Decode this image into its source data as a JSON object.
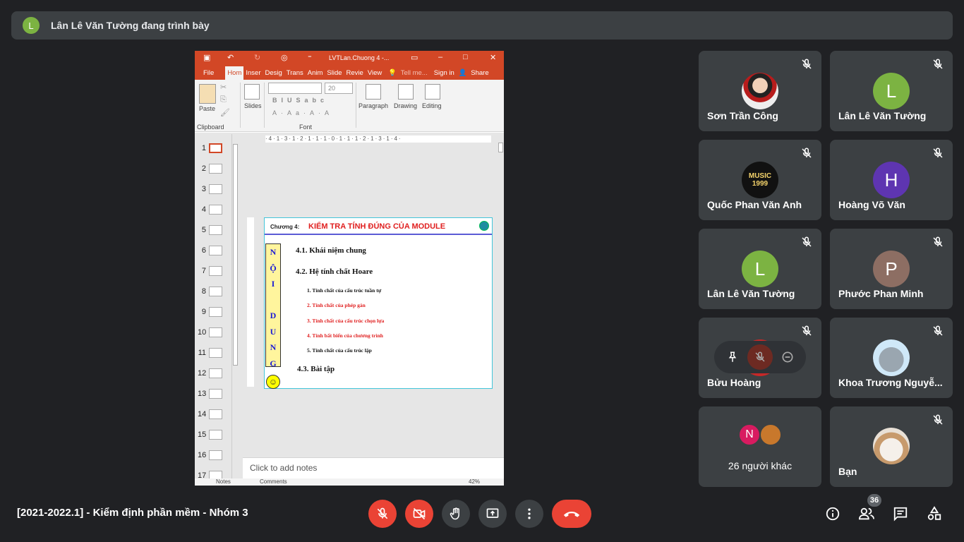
{
  "banner": {
    "avatar_letter": "L",
    "text": "Lân Lê Văn Tường đang trình bày"
  },
  "ppt": {
    "doc_title": "LVTLan.Chuong 4 -...",
    "tabs": [
      "File",
      "Hom",
      "Inser",
      "Desig",
      "Trans",
      "Anim",
      "Slide",
      "Revie",
      "View"
    ],
    "tell_me": "Tell me...",
    "sign_in": "Sign in",
    "share": "Share",
    "ribbon": {
      "paste": "Paste",
      "clipboard": "Clipboard",
      "slides": "Slides",
      "font_size": "20",
      "font": "Font",
      "paragraph": "Paragraph",
      "drawing": "Drawing",
      "editing": "Editing"
    },
    "ruler": "·4·1·3·1·2·1·1·1·0·1·1·1·2·1·3·1·4·",
    "thumbnail_numbers": [
      "1",
      "2",
      "3",
      "4",
      "5",
      "6",
      "7",
      "8",
      "9",
      "10",
      "11",
      "12",
      "13",
      "14",
      "15",
      "16",
      "17"
    ],
    "slide": {
      "chapter": "Chương 4:",
      "title": "KIỂM TRA TÍNH ĐÚNG CỦA MODULE",
      "side_letters": [
        "N",
        "Ộ",
        "I",
        "",
        "D",
        "U",
        "N",
        "G"
      ],
      "smiley": "☺",
      "h1": "4.1. Khái niệm chung",
      "h2": "4.2. Hệ tính chất Hoare",
      "items": [
        "1. Tính chất của cấu trúc tuần tự",
        "2. Tính chất của phép gán",
        "3. Tính chất của cấu trúc chọn lựa",
        "4. Tính bất biến của chương trình",
        "5. Tính chất của cấu trúc lặp"
      ],
      "h3": "4.3. Bài tập"
    },
    "notes_placeholder": "Click to add notes",
    "status": {
      "notes": "Notes",
      "comments": "Comments",
      "zoom": "42%"
    }
  },
  "participants": [
    {
      "name": "Sơn Trần Công",
      "avatar": "photo"
    },
    {
      "name": "Lân Lê Văn Tường",
      "avatar": "L",
      "color": "#7cb342"
    },
    {
      "name": "Quốc Phan Văn Anh",
      "avatar": "MUSIC 1999"
    },
    {
      "name": "Hoàng Võ Văn",
      "avatar": "H",
      "color": "#5e35b1"
    },
    {
      "name": "Lân Lê Văn Tường",
      "avatar": "L",
      "color": "#7cb342"
    },
    {
      "name": "Phước Phan Minh",
      "avatar": "P",
      "color": "#8d6e63"
    },
    {
      "name": "Bửu Hoàng",
      "avatar": "photo"
    },
    {
      "name": "Khoa Trương Nguyễ...",
      "avatar": "photo"
    },
    {
      "name": "26 người khác",
      "avatar": "N",
      "color": "#d81b60"
    },
    {
      "name": "Bạn",
      "avatar": "photo"
    }
  ],
  "bottom": {
    "meeting_title": "[2021-2022.1] - Kiểm định phần mềm - Nhóm 3",
    "participant_count": "36"
  },
  "colors": {
    "bg": "#202124",
    "tile": "#3c4043",
    "red": "#ea4335",
    "ppt_red": "#d24726"
  }
}
